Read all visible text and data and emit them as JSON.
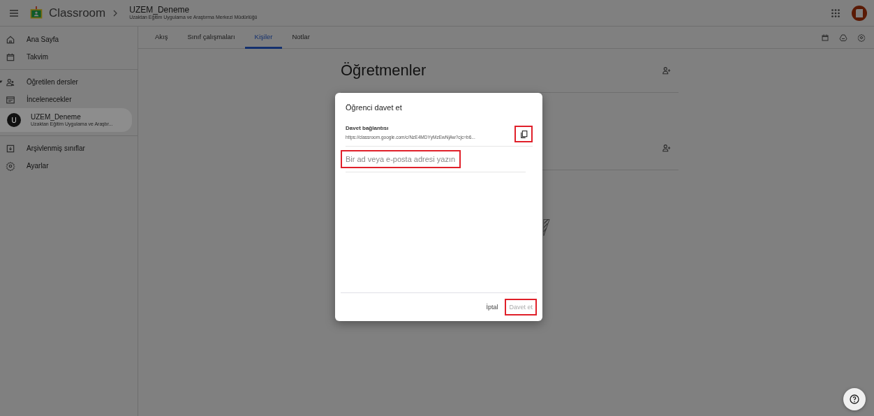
{
  "header": {
    "app_name": "Classroom",
    "class_name": "UZEM_Deneme",
    "class_subtitle": "Uzaktan Eğitim Uygulama ve Araştırma Merkezi Müdürlüğü"
  },
  "sidebar": {
    "items": [
      {
        "kind": "nav",
        "label": "Ana Sayfa",
        "selected": false
      },
      {
        "kind": "nav",
        "label": "Takvim",
        "selected": false
      },
      {
        "kind": "group",
        "label": "Öğretilen dersler",
        "expanded": true,
        "selected": false
      },
      {
        "kind": "nav",
        "label": "İncelenecekler",
        "selected": false
      },
      {
        "kind": "class",
        "avatar": "U",
        "label": "UZEM_Deneme",
        "subtitle": "Uzaktan Eğitim Uygulama ve Araştır...",
        "selected": true
      },
      {
        "kind": "nav",
        "label": "Arşivlenmiş sınıflar",
        "selected": false
      },
      {
        "kind": "nav",
        "label": "Ayarlar",
        "selected": false
      }
    ]
  },
  "tabs": [
    {
      "label": "Akış",
      "selected": false
    },
    {
      "label": "Sınıf çalışmaları",
      "selected": false
    },
    {
      "label": "Kişiler",
      "selected": true
    },
    {
      "label": "Notlar",
      "selected": false
    }
  ],
  "people": {
    "sections": [
      {
        "title": "Öğretmenler",
        "add_button": true
      },
      {
        "add_button": true
      }
    ]
  },
  "dialog": {
    "title": "Öğrenci davet et",
    "link_label": "Davet bağlantısı",
    "link": "https://classroom.google.com/c/NzE4MDYyMzEwNjAw?cjc=b6...",
    "input_placeholder": "Bir ad veya e-posta adresi yazın",
    "buttons": [
      {
        "kind": "cancel",
        "label": "İptal",
        "disabled": false
      },
      {
        "kind": "invite",
        "label": "Davet et",
        "disabled": true
      }
    ]
  }
}
